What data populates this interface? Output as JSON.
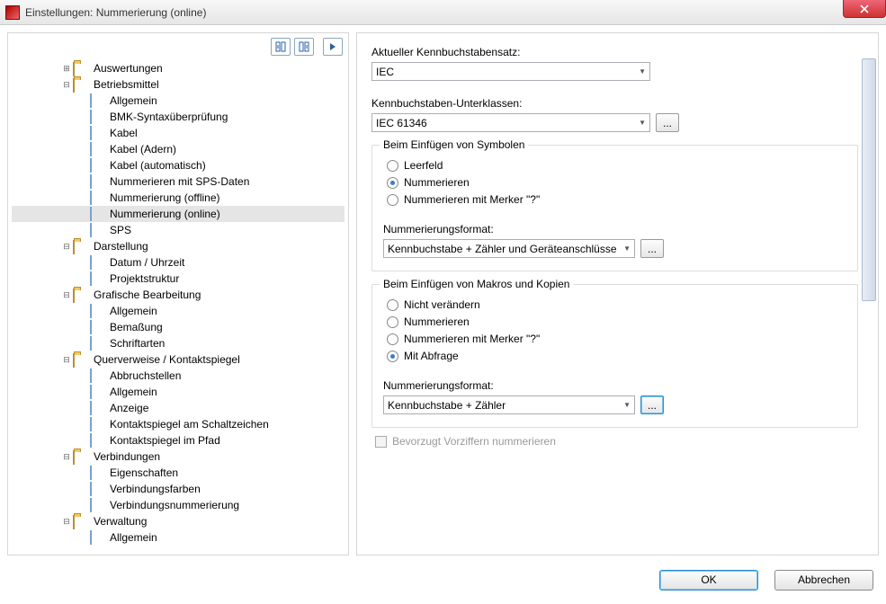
{
  "window": {
    "title": "Einstellungen: Nummerierung (online)"
  },
  "toolbar": {
    "expand_icon": "expand",
    "collapse_icon": "collapse",
    "play_icon": "play"
  },
  "tree": [
    {
      "level": 3,
      "type": "folder",
      "exp": "+",
      "label": "Auswertungen"
    },
    {
      "level": 3,
      "type": "folder",
      "exp": "-",
      "label": "Betriebsmittel"
    },
    {
      "level": 4,
      "type": "page",
      "label": "Allgemein"
    },
    {
      "level": 4,
      "type": "page",
      "label": "BMK-Syntaxüberprüfung"
    },
    {
      "level": 4,
      "type": "page",
      "label": "Kabel"
    },
    {
      "level": 4,
      "type": "page",
      "label": "Kabel (Adern)"
    },
    {
      "level": 4,
      "type": "page",
      "label": "Kabel (automatisch)"
    },
    {
      "level": 4,
      "type": "page",
      "label": "Nummerieren mit SPS-Daten"
    },
    {
      "level": 4,
      "type": "page",
      "label": "Nummerierung (offline)"
    },
    {
      "level": 4,
      "type": "page",
      "label": "Nummerierung (online)",
      "selected": true
    },
    {
      "level": 4,
      "type": "page",
      "label": "SPS"
    },
    {
      "level": 3,
      "type": "folder",
      "exp": "-",
      "label": "Darstellung"
    },
    {
      "level": 4,
      "type": "page",
      "label": "Datum / Uhrzeit"
    },
    {
      "level": 4,
      "type": "page",
      "label": "Projektstruktur"
    },
    {
      "level": 3,
      "type": "folder",
      "exp": "-",
      "label": "Grafische Bearbeitung"
    },
    {
      "level": 4,
      "type": "page",
      "label": "Allgemein"
    },
    {
      "level": 4,
      "type": "page",
      "label": "Bemaßung"
    },
    {
      "level": 4,
      "type": "page",
      "label": "Schriftarten"
    },
    {
      "level": 3,
      "type": "folder",
      "exp": "-",
      "label": "Querverweise / Kontaktspiegel"
    },
    {
      "level": 4,
      "type": "page",
      "label": "Abbruchstellen"
    },
    {
      "level": 4,
      "type": "page",
      "label": "Allgemein"
    },
    {
      "level": 4,
      "type": "page",
      "label": "Anzeige"
    },
    {
      "level": 4,
      "type": "page",
      "label": "Kontaktspiegel am Schaltzeichen"
    },
    {
      "level": 4,
      "type": "page",
      "label": "Kontaktspiegel im Pfad"
    },
    {
      "level": 3,
      "type": "folder",
      "exp": "-",
      "label": "Verbindungen"
    },
    {
      "level": 4,
      "type": "page",
      "label": "Eigenschaften"
    },
    {
      "level": 4,
      "type": "page",
      "label": "Verbindungsfarben"
    },
    {
      "level": 4,
      "type": "page",
      "label": "Verbindungsnummerierung"
    },
    {
      "level": 3,
      "type": "folder",
      "exp": "-",
      "label": "Verwaltung"
    },
    {
      "level": 4,
      "type": "page",
      "label": "Allgemein"
    }
  ],
  "form": {
    "aktueller_label": "Aktueller Kennbuchstabensatz:",
    "aktueller_value": "IEC",
    "unterklassen_label": "Kennbuchstaben-Unterklassen:",
    "unterklassen_value": "IEC 61346",
    "ellipsis": "...",
    "group_symbols": {
      "legend": "Beim Einfügen von Symbolen",
      "options": [
        {
          "label": "Leerfeld",
          "checked": false
        },
        {
          "label": "Nummerieren",
          "checked": true
        },
        {
          "label": "Nummerieren mit Merker \"?\"",
          "checked": false
        }
      ],
      "format_label": "Nummerierungsformat:",
      "format_value": "Kennbuchstabe + Zähler und Geräteanschlüsse"
    },
    "group_macros": {
      "legend": "Beim Einfügen von Makros und Kopien",
      "options": [
        {
          "label": "Nicht verändern",
          "checked": false
        },
        {
          "label": "Nummerieren",
          "checked": false
        },
        {
          "label": "Nummerieren mit Merker \"?\"",
          "checked": false
        },
        {
          "label": "Mit Abfrage",
          "checked": true
        }
      ],
      "format_label": "Nummerierungsformat:",
      "format_value": "Kennbuchstabe + Zähler"
    },
    "checkbox_label": "Bevorzugt Vorziffern nummerieren"
  },
  "footer": {
    "ok": "OK",
    "cancel": "Abbrechen"
  }
}
